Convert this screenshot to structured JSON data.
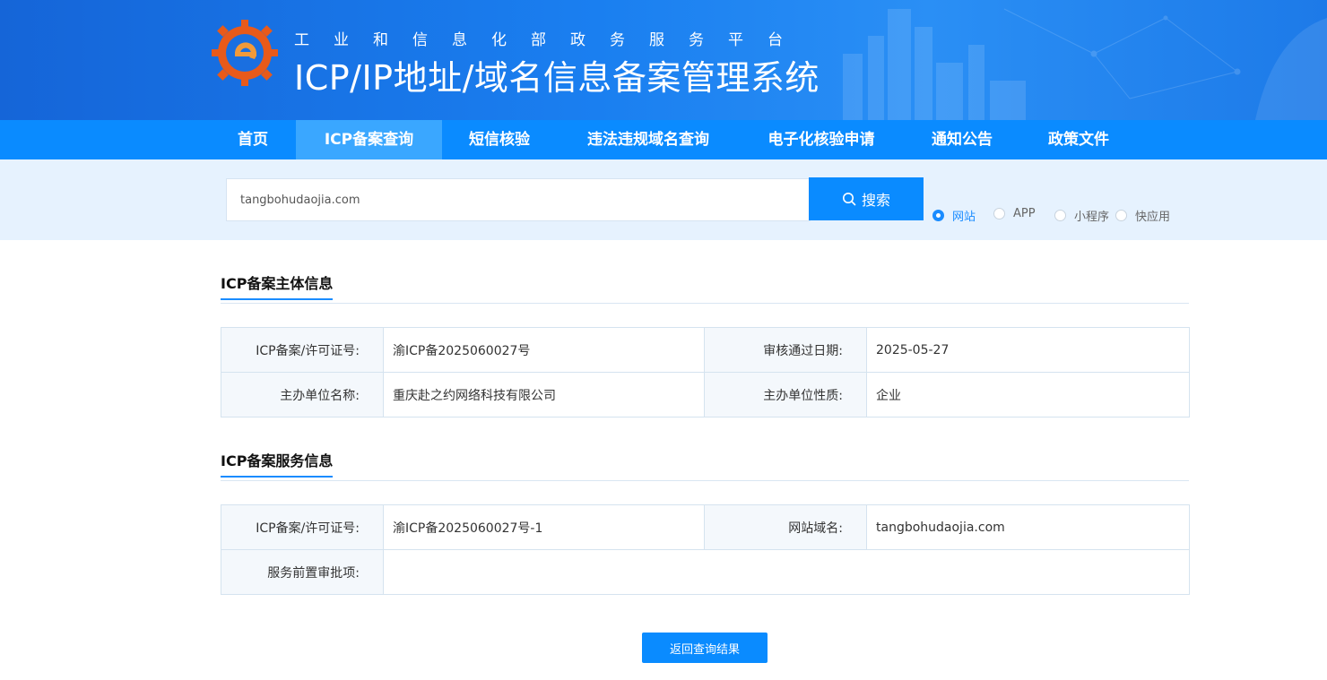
{
  "header": {
    "subtitle": "工业和信息化部政务服务平台",
    "title": "ICP/IP地址/域名信息备案管理系统"
  },
  "nav": {
    "items": [
      {
        "label": "首页"
      },
      {
        "label": "ICP备案查询"
      },
      {
        "label": "短信核验"
      },
      {
        "label": "违法违规域名查询"
      },
      {
        "label": "电子化核验申请"
      },
      {
        "label": "通知公告"
      },
      {
        "label": "政策文件"
      }
    ],
    "active": "ICP备案查询"
  },
  "search": {
    "value": "tangbohudaojia.com",
    "button_label": "搜索",
    "types": [
      {
        "label": "网站",
        "checked": true
      },
      {
        "label": "APP",
        "checked": false
      },
      {
        "label": "小程序",
        "checked": false
      },
      {
        "label": "快应用",
        "checked": false
      }
    ]
  },
  "subject_info": {
    "title": "ICP备案主体信息",
    "rows": [
      {
        "label1": "ICP备案/许可证号:",
        "value1": "渝ICP备2025060027号",
        "label2": "审核通过日期:",
        "value2": "2025-05-27"
      },
      {
        "label1": "主办单位名称:",
        "value1": "重庆赴之约网络科技有限公司",
        "label2": "主办单位性质:",
        "value2": "企业"
      }
    ]
  },
  "service_info": {
    "title": "ICP备案服务信息",
    "license_label": "ICP备案/许可证号:",
    "license_value": "渝ICP备2025060027号-1",
    "domain_label": "网站域名:",
    "domain_value": "tangbohudaojia.com",
    "approval_label": "服务前置审批项:",
    "approval_value": ""
  },
  "back_button": "返回查询结果",
  "colors": {
    "primary": "#0a8bff",
    "nav_active": "#3aa7ff",
    "search_band": "#e6f2fe",
    "label_cell": "#f4f8fc"
  }
}
